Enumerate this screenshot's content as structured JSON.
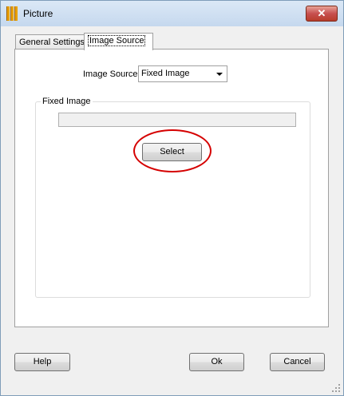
{
  "window": {
    "title": "Picture",
    "close_glyph": "✕"
  },
  "tabs": [
    {
      "label": "General Settings",
      "active": false
    },
    {
      "label": "Image Source",
      "active": true
    }
  ],
  "image_source": {
    "label": "Image Source",
    "selected": "Fixed Image"
  },
  "fixed_image": {
    "group_label": "Fixed Image",
    "path_value": "",
    "select_label": "Select"
  },
  "footer": {
    "help_label": "Help",
    "ok_label": "Ok",
    "cancel_label": "Cancel"
  },
  "colors": {
    "annotation_ellipse": "#d50000",
    "close_button": "#c75050"
  },
  "icons": [
    "picture-app-icon",
    "close-icon",
    "dropdown-arrow-icon",
    "resize-grip-icon"
  ]
}
